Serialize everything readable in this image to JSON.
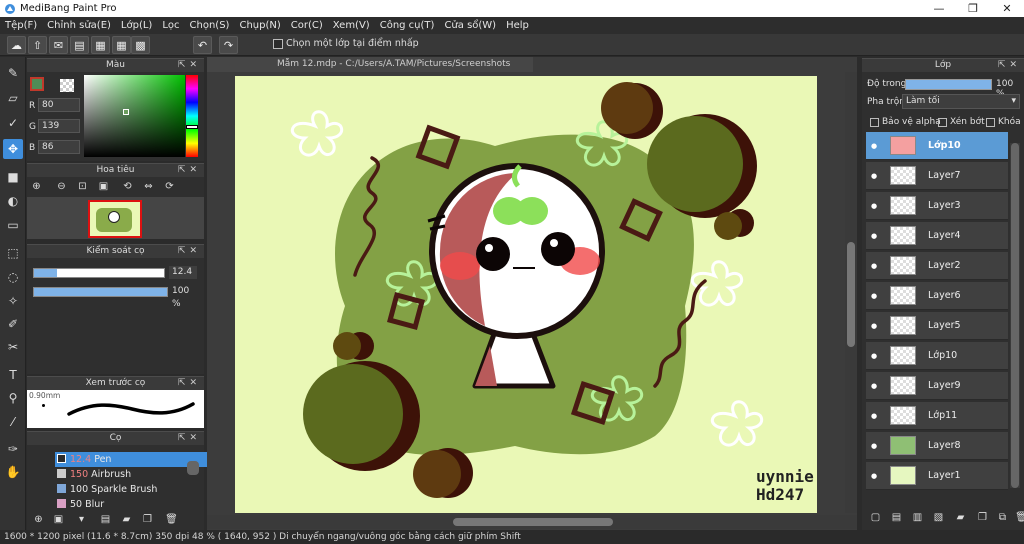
{
  "window": {
    "title": "MediBang Paint Pro",
    "buttons": [
      "—",
      "❐",
      "✕"
    ]
  },
  "menu": [
    "Tệp(F)",
    "Chỉnh sửa(E)",
    "Lớp(L)",
    "Lọc",
    "Chọn(S)",
    "Chụp(N)",
    "Cor(C)",
    "Xem(V)",
    "Công cụ(T)",
    "Cửa sổ(W)",
    "Help"
  ],
  "toolbar": {
    "checkbox_label": "Chọn một lớp tại điểm nhấp"
  },
  "color_panel": {
    "title": "Màu",
    "r_label": "R",
    "g_label": "G",
    "b_label": "B",
    "r": "80",
    "g": "139",
    "b": "86",
    "primary_color": "#508b56"
  },
  "navigator_panel": {
    "title": "Hoa tiêu"
  },
  "brush_control": {
    "title": "Kiểm soát cọ",
    "size": "12.4",
    "size_fraction": 0.18,
    "opacity": "100 %",
    "opacity_fraction": 1.0
  },
  "brush_preview": {
    "title": "Xem trước cọ",
    "size_label": "0.90mm"
  },
  "brush_list": {
    "title": "Cọ",
    "items": [
      {
        "size": "12.4",
        "name": "Pen",
        "selected": true,
        "swatch": "#2b2b2b"
      },
      {
        "size": "150",
        "name": "Airbrush",
        "selected": false,
        "swatch": "#cccccc"
      },
      {
        "size": "100",
        "name": "Sparkle Brush",
        "selected": false,
        "swatch": "#7fa7d8"
      },
      {
        "size": "50",
        "name": "Blur",
        "selected": false,
        "swatch": "#d9a0c4"
      }
    ]
  },
  "document": {
    "tab": "Mẫm 12.mdp - C:/Users/A.TAM/Pictures/Screenshots",
    "signature": "uynnie Hd247"
  },
  "layer_panel": {
    "title": "Lớp",
    "opacity_label": "Độ trong",
    "opacity_value": "100 %",
    "opacity_fraction": 1.0,
    "blend_label": "Pha trộn",
    "blend_value": "Làm tối",
    "protect_alpha": "Bảo vệ alpha",
    "clip": "Xén bớt",
    "lock": "Khóa",
    "layers": [
      {
        "name": "Lớp10",
        "selected": true,
        "thumb_color": "#f4a0a0"
      },
      {
        "name": "Layer7",
        "selected": false,
        "thumb_color": ""
      },
      {
        "name": "Layer3",
        "selected": false,
        "thumb_color": ""
      },
      {
        "name": "Layer4",
        "selected": false,
        "thumb_color": ""
      },
      {
        "name": "Layer2",
        "selected": false,
        "thumb_color": ""
      },
      {
        "name": "Layer6",
        "selected": false,
        "thumb_color": ""
      },
      {
        "name": "Layer5",
        "selected": false,
        "thumb_color": ""
      },
      {
        "name": "Lớp10",
        "selected": false,
        "thumb_color": ""
      },
      {
        "name": "Layer9",
        "selected": false,
        "thumb_color": ""
      },
      {
        "name": "Lớp11",
        "selected": false,
        "thumb_color": ""
      },
      {
        "name": "Layer8",
        "selected": false,
        "thumb_color": "#8fbf74"
      },
      {
        "name": "Layer1",
        "selected": false,
        "thumb_color": "#e6f7c0"
      }
    ]
  },
  "status": "1600 * 1200 pixel   (11.6 * 8.7cm)   350 dpi   48 %   ( 1640, 952 )   Di chuyển ngang/vuông góc bằng cách giữ phím Shift"
}
